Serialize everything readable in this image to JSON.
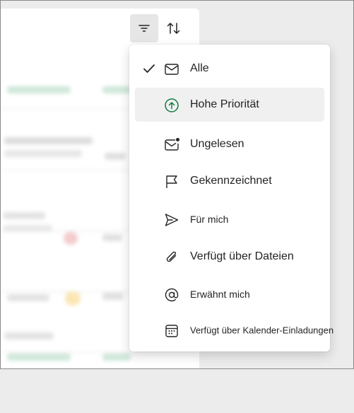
{
  "toolbar": {
    "filter_icon": "filter-icon",
    "sort_icon": "sort-arrows-icon"
  },
  "filter_menu": {
    "items": [
      {
        "label": "Alle",
        "icon": "mail-icon",
        "checked": true
      },
      {
        "label": "Hohe Priorität",
        "icon": "arrow-up-circle-icon",
        "highlighted": true
      },
      {
        "label": "Ungelesen",
        "icon": "mail-unread-icon"
      },
      {
        "label": "Gekennzeichnet",
        "icon": "flag-icon"
      },
      {
        "label": "Für mich",
        "icon": "send-icon"
      },
      {
        "label": "Verfügt über Dateien",
        "icon": "attach-icon"
      },
      {
        "label": "Erwähnt mich",
        "icon": "at-icon"
      },
      {
        "label": "Verfügt über Kalender-Einladungen",
        "icon": "calendar-icon"
      }
    ]
  },
  "colors": {
    "accent_green": "#107c41",
    "menu_text": "#242424"
  }
}
